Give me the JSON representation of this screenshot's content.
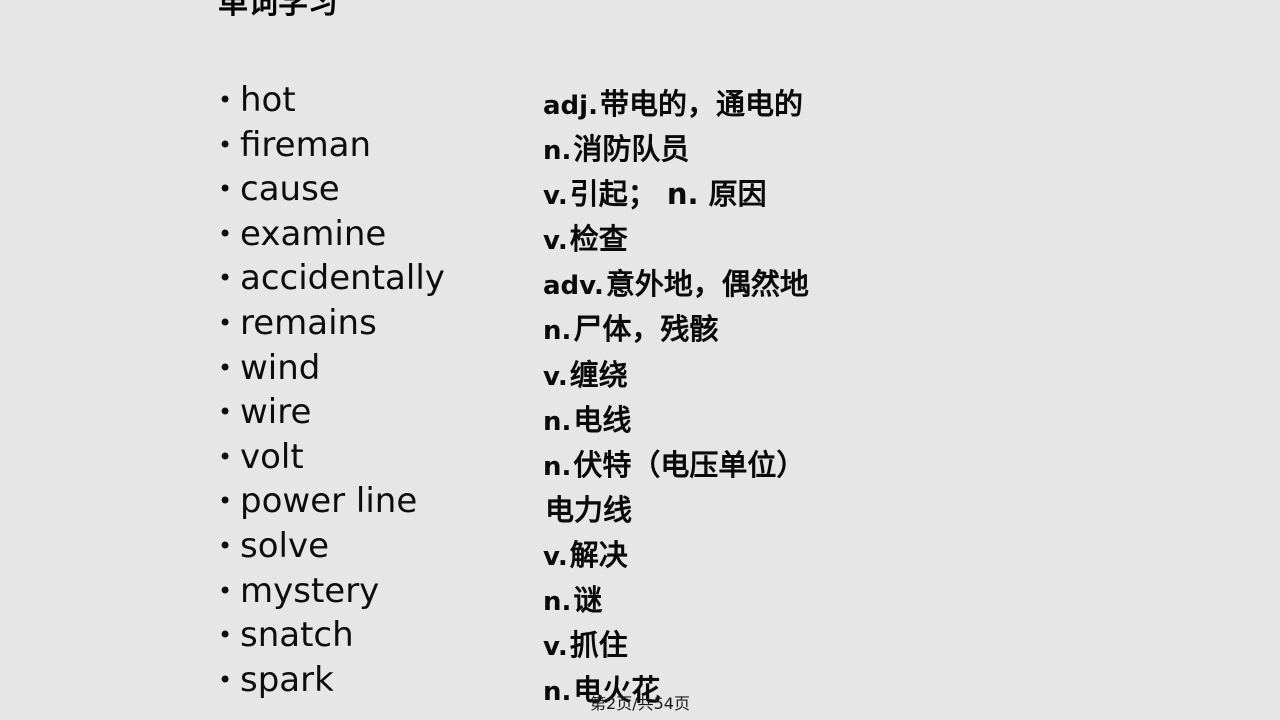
{
  "slide": {
    "title": "单词学习",
    "background_color": "#e6e6e6",
    "text_color": "#000000"
  },
  "vocabulary": [
    {
      "bullet": "•",
      "word": "hot",
      "pos": "adj.",
      "gloss": "带电的，通电的"
    },
    {
      "bullet": "•",
      "word": "fireman",
      "pos": "n.",
      "gloss": "消防队员"
    },
    {
      "bullet": "•",
      "word": "cause",
      "pos": "v.",
      "gloss": "引起； n. 原因"
    },
    {
      "bullet": "•",
      "word": "examine",
      "pos": "v.",
      "gloss": "检查"
    },
    {
      "bullet": "•",
      "word": "accidentally",
      "pos": "adv.",
      "gloss": "意外地，偶然地"
    },
    {
      "bullet": "•",
      "word": "remains",
      "pos": "n.",
      "gloss": "尸体，残骸"
    },
    {
      "bullet": "•",
      "word": "wind",
      "pos": "v.",
      "gloss": "缠绕"
    },
    {
      "bullet": "•",
      "word": "wire",
      "pos": "n.",
      "gloss": "电线"
    },
    {
      "bullet": "•",
      "word": "volt",
      "pos": "n.",
      "gloss": "伏特（电压单位）"
    },
    {
      "bullet": "•",
      "word": "power line",
      "pos": "",
      "gloss": "电力线"
    },
    {
      "bullet": "•",
      "word": "solve",
      "pos": "v.",
      "gloss": "解决"
    },
    {
      "bullet": "•",
      "word": "mystery",
      "pos": "n.",
      "gloss": "谜"
    },
    {
      "bullet": "•",
      "word": "snatch",
      "pos": "v.",
      "gloss": "抓住"
    },
    {
      "bullet": "•",
      "word": "spark",
      "pos": "n.",
      "gloss": "电火花"
    }
  ],
  "footer": {
    "page_indicator": "第2页/共54页"
  }
}
